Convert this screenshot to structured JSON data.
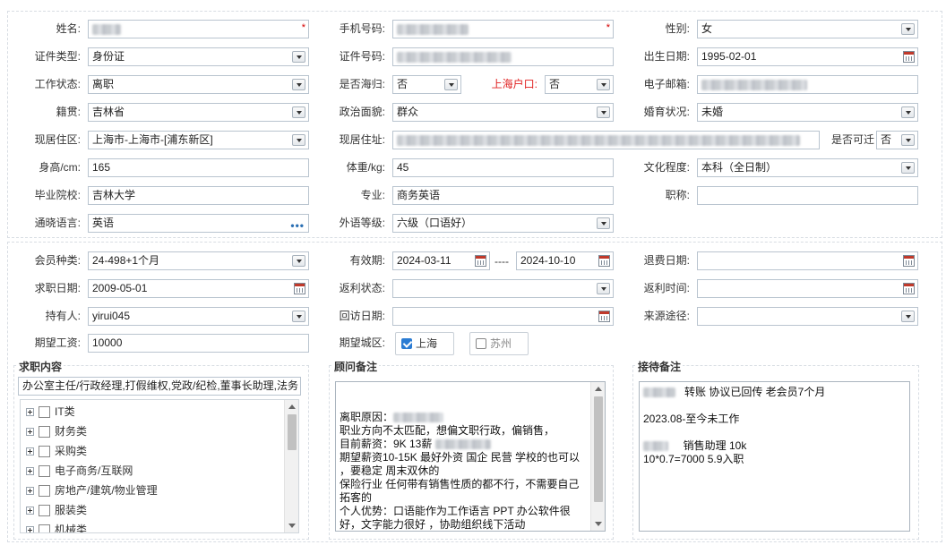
{
  "personal": {
    "name_label": "姓名:",
    "mobile_label": "手机号码:",
    "gender_label": "性别:",
    "gender_value": "女",
    "id_type_label": "证件类型:",
    "id_type_value": "身份证",
    "id_no_label": "证件号码:",
    "birth_label": "出生日期:",
    "birth_value": "1995-02-01",
    "work_status_label": "工作状态:",
    "work_status_value": "离职",
    "returnee_label": "是否海归:",
    "returnee_value": "否",
    "shanghai_hukou_label": "上海户口:",
    "shanghai_hukou_value": "否",
    "email_label": "电子邮箱:",
    "native_label": "籍贯:",
    "native_value": "吉林省",
    "political_label": "政治面貌:",
    "political_value": "群众",
    "marital_label": "婚育状况:",
    "marital_value": "未婚",
    "residence_area_label": "现居住区:",
    "residence_area_value": "上海市-上海市-[浦东新区]",
    "residence_addr_label": "现居住址:",
    "relocate_label": "是否可迁",
    "relocate_value": "否",
    "height_label": "身高/cm:",
    "height_value": "165",
    "weight_label": "体重/kg:",
    "weight_value": "45",
    "education_label": "文化程度:",
    "education_value": "本科（全日制）",
    "school_label": "毕业院校:",
    "school_value": "吉林大学",
    "major_label": "专业:",
    "major_value": "商务英语",
    "title_label": "职称:",
    "title_value": "",
    "language_label": "通晓语言:",
    "language_value": "英语",
    "fl_level_label": "外语等级:",
    "fl_level_value": "六级（口语好）"
  },
  "membership": {
    "member_type_label": "会员种类:",
    "member_type_value": "24-498+1个月",
    "valid_label": "有效期:",
    "valid_from": "2024-03-11",
    "valid_sep": "----",
    "valid_to": "2024-10-10",
    "refund_date_label": "退费日期:",
    "refund_date_value": "",
    "job_date_label": "求职日期:",
    "job_date_value": "2009-05-01",
    "rebate_status_label": "返利状态:",
    "rebate_status_value": "",
    "rebate_time_label": "返利时间:",
    "rebate_time_value": "",
    "holder_label": "持有人:",
    "holder_value": "yirui045",
    "visit_date_label": "回访日期:",
    "visit_date_value": "",
    "source_label": "来源途径:",
    "source_value": "",
    "salary_label": "期望工资:",
    "salary_value": "10000",
    "city_label": "期望城区:",
    "cities": [
      {
        "label": "上海",
        "checked": true
      },
      {
        "label": "苏州",
        "checked": false
      }
    ]
  },
  "job_content": {
    "legend": "求职内容",
    "selected": "办公室主任/行政经理,打假维权,党政/纪检,董事长助理,法务",
    "categories": [
      "IT类",
      "财务类",
      "采购类",
      "电子商务/互联网",
      "房地产/建筑/物业管理",
      "服装类",
      "机械类"
    ]
  },
  "consultant_note": {
    "legend": "顾问备注",
    "lines": [
      "离职原因：",
      "职业方向不太匹配，想偏文职行政，偏销售，",
      "目前薪资：9K  13薪",
      "期望薪资10-15K  最好外资 国企 民营 学校的也可以 ，要稳定 周末双休的",
      "保险行业 任何带有销售性质的都不行，不需要自己拓客的",
      "个人优势：口语能作为工作语言  PPT 办公软件很好，文字能力很好 ，协助组织线下活动"
    ]
  },
  "reception_note": {
    "legend": "接待备注",
    "line1": "转账 协议已回传  老会员7个月",
    "line2": "2023.08-至今未工作",
    "line3": "销售助理 10k",
    "line4": "10*0.7=7000  5.9入职"
  }
}
